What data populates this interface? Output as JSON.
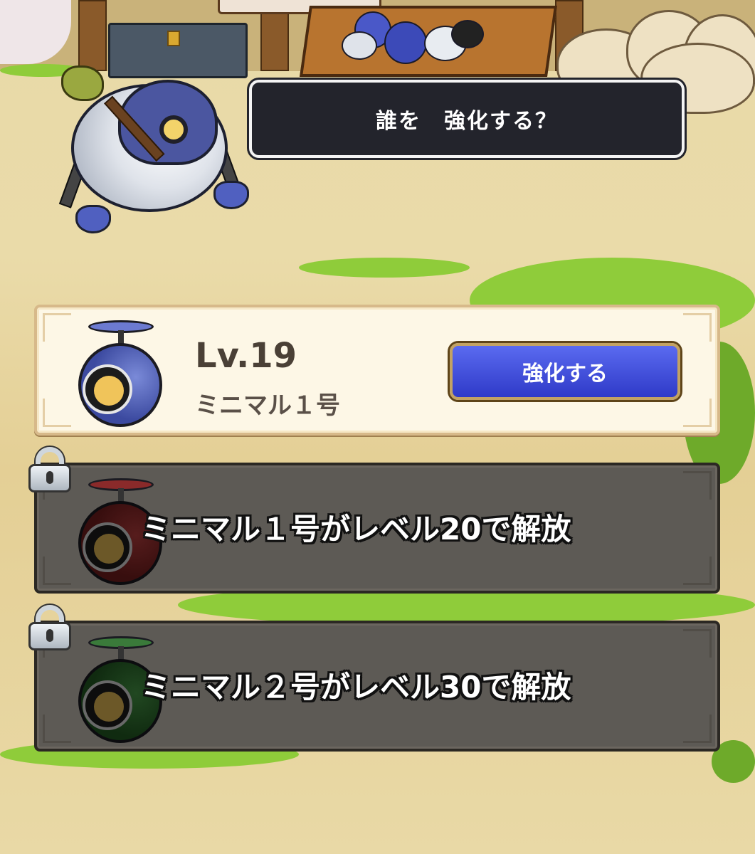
{
  "prompt": {
    "text": "誰を　強化する？"
  },
  "cards": [
    {
      "level": "Lv.19",
      "name": "ミニマル１号",
      "button_label": "強化する",
      "icon": "minimal-bot-blue-icon",
      "locked": false
    },
    {
      "unlock_text": "ミニマル１号がレベル20で解放",
      "icon": "minimal-bot-red-icon",
      "locked": true
    },
    {
      "unlock_text": "ミニマル２号がレベル30で解放",
      "icon": "minimal-bot-green-icon",
      "locked": true
    }
  ],
  "colors": {
    "button_blue": "#3a46d8",
    "card_cream": "#fdf7e6",
    "card_locked": "#5d5a55",
    "prompt_bg": "#23242c"
  }
}
